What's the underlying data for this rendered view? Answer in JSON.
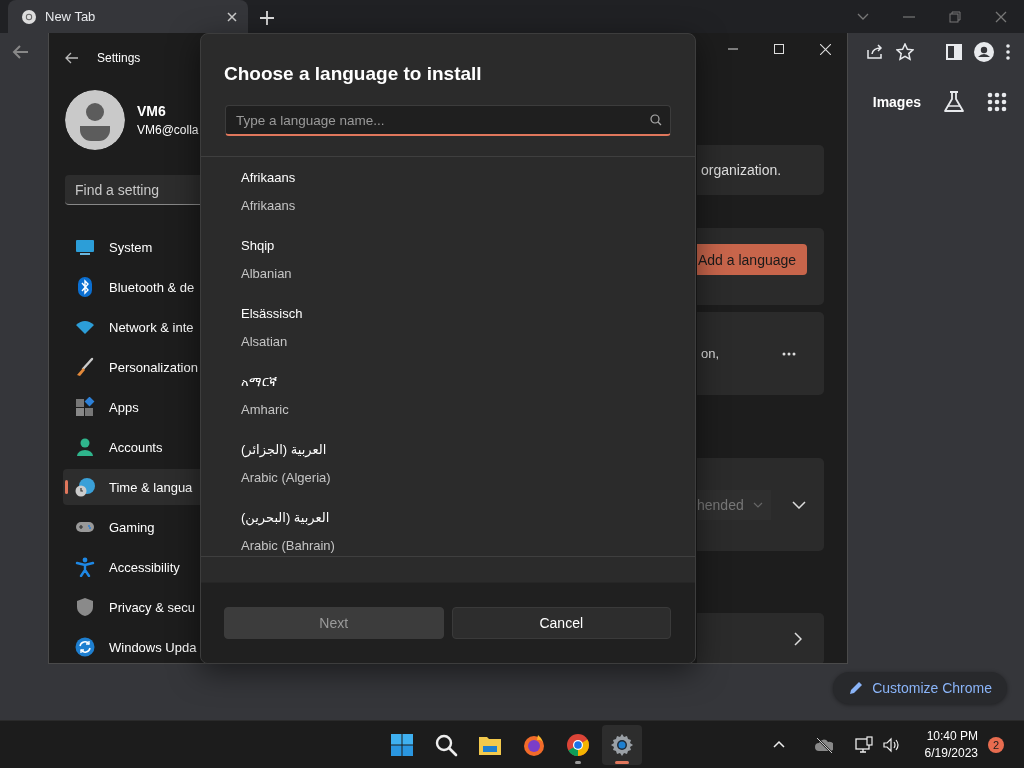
{
  "browser": {
    "tabs": [
      {
        "title": "New Tab",
        "selected": true
      }
    ],
    "page_links": [
      {
        "label": "Images"
      }
    ],
    "customize_button": {
      "label": "Customize Chrome"
    }
  },
  "settings": {
    "title": "Settings",
    "user": {
      "name": "VM6",
      "email": "VM6@colla"
    },
    "search": {
      "placeholder": "Find a setting"
    },
    "nav": [
      {
        "label": "System",
        "kind": "system",
        "selected": false
      },
      {
        "label": "Bluetooth & de",
        "kind": "bluetooth",
        "selected": false
      },
      {
        "label": "Network & inte",
        "kind": "network",
        "selected": false
      },
      {
        "label": "Personalization",
        "kind": "personalization",
        "selected": false
      },
      {
        "label": "Apps",
        "kind": "apps",
        "selected": false
      },
      {
        "label": "Accounts",
        "kind": "accounts",
        "selected": false
      },
      {
        "label": "Time & langua",
        "kind": "time",
        "selected": true
      },
      {
        "label": "Gaming",
        "kind": "gaming",
        "selected": false
      },
      {
        "label": "Accessibility",
        "kind": "accessibility",
        "selected": false
      },
      {
        "label": "Privacy & secu",
        "kind": "privacy",
        "selected": false
      },
      {
        "label": "Windows Upda",
        "kind": "update",
        "selected": false
      }
    ],
    "cards": [
      {
        "kind": "text",
        "text": "organization."
      },
      {
        "kind": "button",
        "label": "Add a language"
      },
      {
        "kind": "more",
        "text": "on,"
      },
      {
        "kind": "dropdown",
        "value": "hended"
      },
      {
        "kind": "link"
      }
    ]
  },
  "dialog": {
    "title": "Choose a language to install",
    "search": {
      "placeholder": "Type a language name...",
      "focused": true
    },
    "languages": [
      {
        "name": "Afrikaans",
        "english": "Afrikaans"
      },
      {
        "name": "Shqip",
        "english": "Albanian"
      },
      {
        "name": "Elsässisch",
        "english": "Alsatian"
      },
      {
        "name": "አማርኛ",
        "english": "Amharic"
      },
      {
        "name": "العربية (الجزائر)",
        "english": "Arabic (Algeria)"
      },
      {
        "name": "العربية (البحرين)",
        "english": "Arabic (Bahrain)"
      }
    ],
    "buttons": [
      {
        "label": "Next",
        "kind": "primary",
        "disabled": true
      },
      {
        "label": "Cancel",
        "kind": "secondary",
        "disabled": false
      }
    ]
  },
  "taskbar": {
    "apps": [
      {
        "kind": "start",
        "running": false,
        "selected": false
      },
      {
        "kind": "search",
        "running": false,
        "selected": false
      },
      {
        "kind": "files",
        "running": false,
        "selected": false
      },
      {
        "kind": "firefox",
        "running": false,
        "selected": false
      },
      {
        "kind": "chrome",
        "running": true,
        "selected": false
      },
      {
        "kind": "settings",
        "running": true,
        "selected": true
      }
    ],
    "clock": {
      "time": "10:40 PM",
      "date": "6/19/2023"
    },
    "notification_count": "2"
  }
}
